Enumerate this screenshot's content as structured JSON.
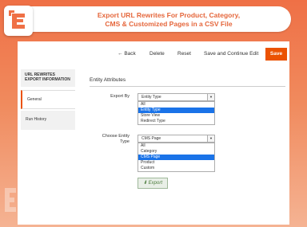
{
  "header": {
    "title_line1": "Export URL Rewrites For Product, Category,",
    "title_line2": "CMS & Customized Pages in a CSV File"
  },
  "toolbar": {
    "back_label": "Back",
    "delete_label": "Delete",
    "reset_label": "Reset",
    "save_continue_label": "Save and Continue Edit",
    "save_label": "Save"
  },
  "sidebar": {
    "title": "URL REWRITES EXPORT INFORMATION",
    "items": [
      {
        "label": "General"
      },
      {
        "label": "Run History"
      }
    ]
  },
  "main": {
    "section_title": "Entity Attributes",
    "export_by": {
      "label": "Export By",
      "selected": "Entity Type",
      "options": [
        "All",
        "Entity Type",
        "Store View",
        "Redirect Type"
      ],
      "highlighted": "Entity Type"
    },
    "entity_type": {
      "label_line1": "Choose Entity",
      "label_line2": "Type",
      "selected": "CMS Page",
      "options": [
        "All",
        "Category",
        "CMS Page",
        "Product",
        "Custom"
      ],
      "highlighted": "CMS Page"
    },
    "export_label": "Export"
  },
  "colors": {
    "accent": "#eb5202",
    "title": "#e5663b",
    "highlight": "#1a73e8"
  }
}
